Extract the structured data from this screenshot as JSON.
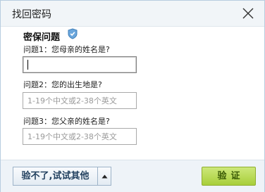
{
  "dialog": {
    "title": "找回密码",
    "close_icon": "close-icon"
  },
  "section": {
    "title": "密保问题",
    "icon": "shield-icon"
  },
  "questions": [
    {
      "label": "问题1：您母亲的姓名是?",
      "value": "",
      "placeholder": ""
    },
    {
      "label": "问题2：您的出生地是?",
      "value": "",
      "placeholder": "1-19个中文或2-38个英文"
    },
    {
      "label": "问题3：您父亲的姓名是?",
      "value": "",
      "placeholder": "1-19个中文或2-38个英文"
    }
  ],
  "footer": {
    "alt_label": "验不了,试试其他",
    "alt_arrow_icon": "triangle-up-icon",
    "verify_label": "验证"
  },
  "colors": {
    "titlebar_bg": "#f1f5f8",
    "footer_bg": "#eef3f8",
    "verify_green": "#a8cf3a",
    "shield_blue": "#6aa6dc"
  }
}
